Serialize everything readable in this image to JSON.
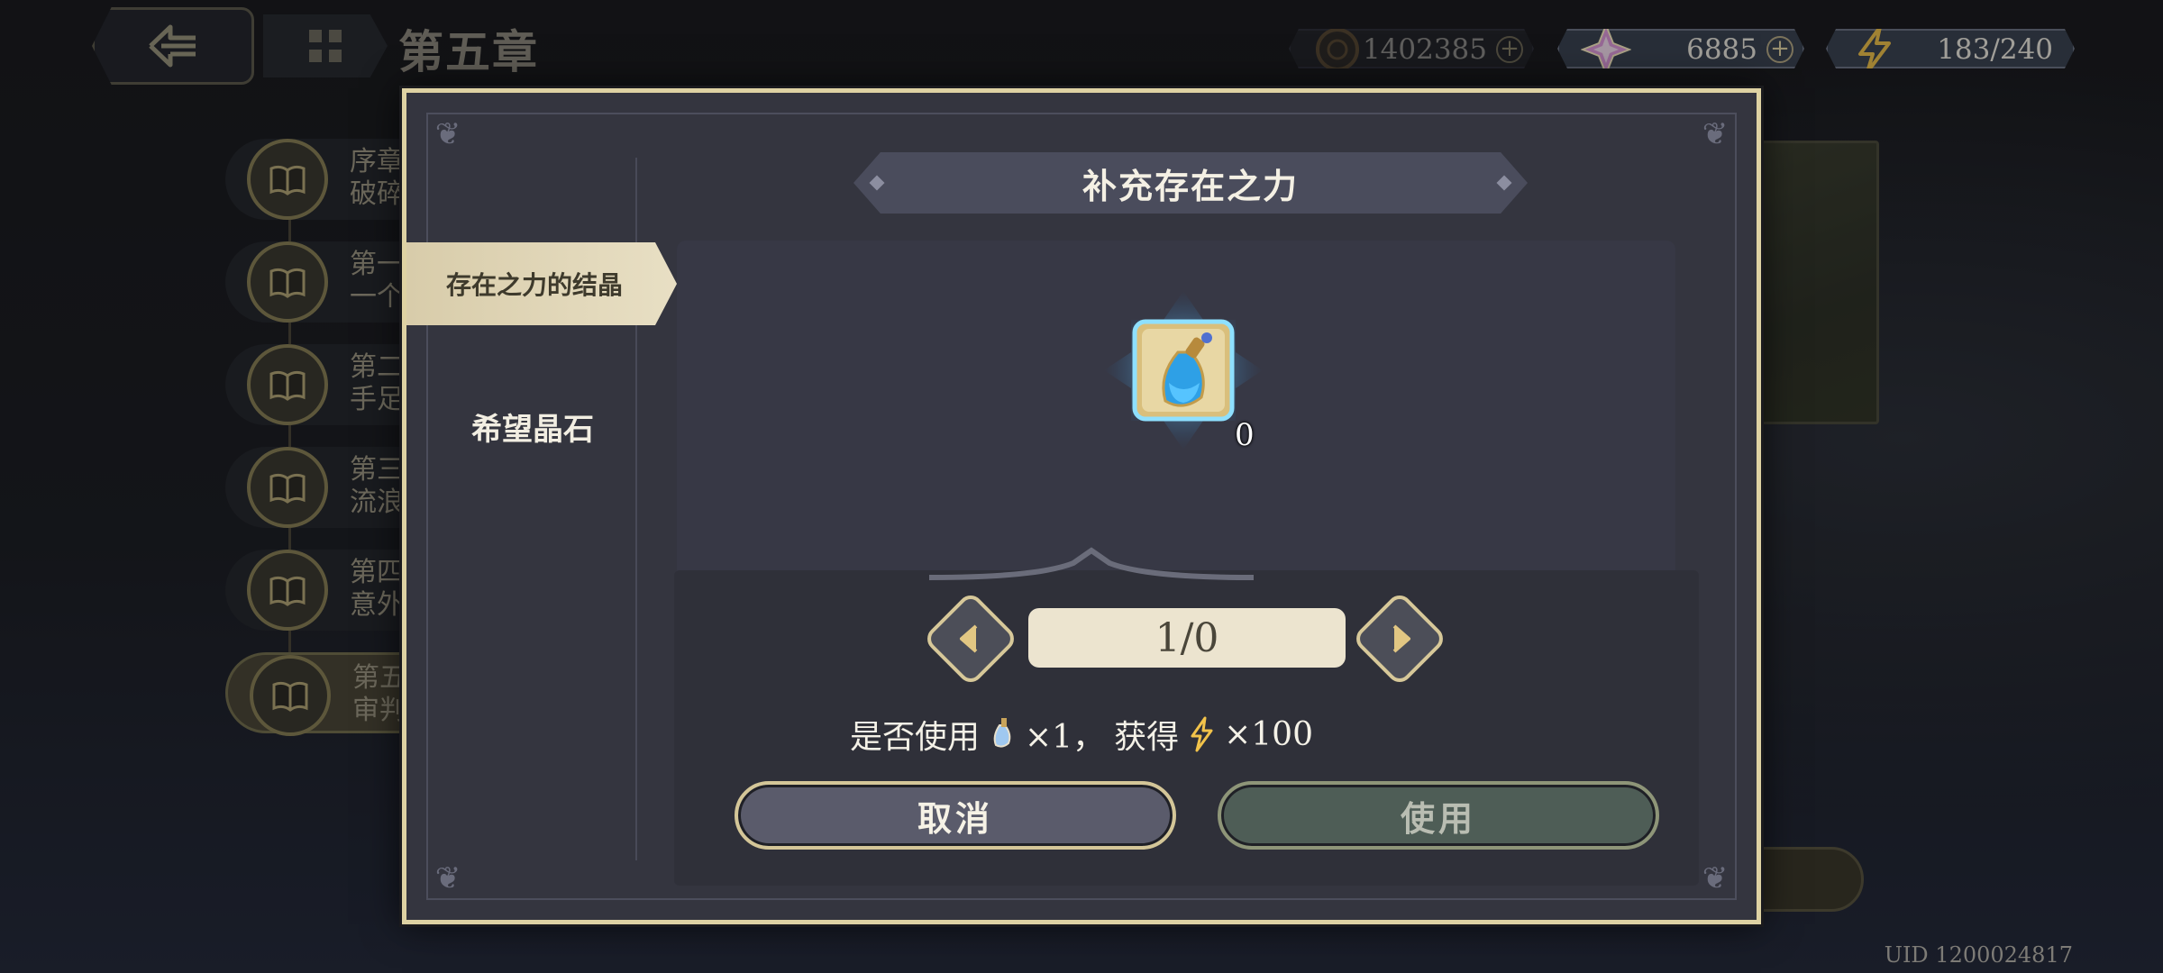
{
  "header": {
    "chapter_title": "第五章",
    "resources": [
      {
        "icon": "coin-icon",
        "value": "1402385",
        "has_plus": true
      },
      {
        "icon": "crystal-icon",
        "value": "6885",
        "has_plus": true
      },
      {
        "icon": "energy-icon",
        "value": "183/240",
        "has_plus": false
      }
    ]
  },
  "chapters": [
    {
      "line1": "序章",
      "line2": "破碎"
    },
    {
      "line1": "第一",
      "line2": "一个"
    },
    {
      "line1": "第二",
      "line2": "手足"
    },
    {
      "line1": "第三",
      "line2": "流浪"
    },
    {
      "line1": "第四",
      "line2": "意外"
    },
    {
      "line1": "第五",
      "line2": "审判",
      "active": true
    }
  ],
  "dialog": {
    "title": "补充存在之力",
    "tabs": [
      {
        "label": "存在之力的结晶",
        "selected": true
      },
      {
        "label": "希望晶石",
        "selected": false
      }
    ],
    "item": {
      "icon": "potion-icon",
      "count": "0"
    },
    "quantity": "1/0",
    "confirm": {
      "prefix": "是否使用",
      "use_amount": "×1，",
      "gain_text": "获得",
      "gain_amount": "×100"
    },
    "cancel_label": "取消",
    "use_label": "使用"
  },
  "footer": {
    "uid": "UID 1200024817"
  },
  "colors": {
    "accent_gold": "#ded2a3",
    "panel": "#34353f",
    "energy": "#f2c34a",
    "crystal": "#d68ad8"
  }
}
